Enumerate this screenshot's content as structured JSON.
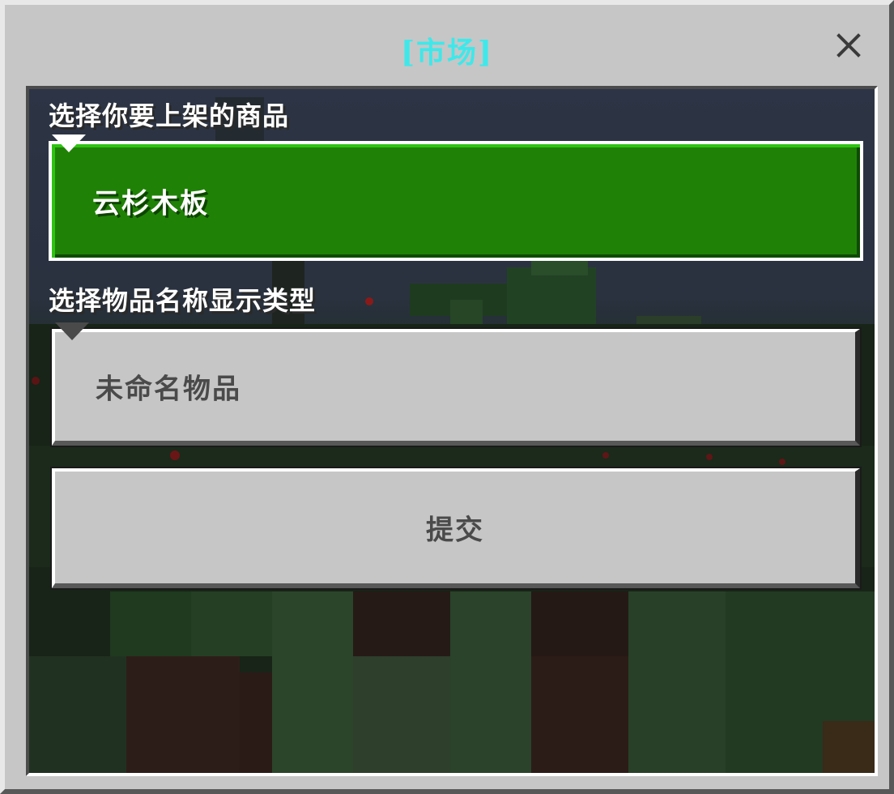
{
  "dialog": {
    "title": "[市场]",
    "title_color": "#3ee8ea",
    "close_icon": "close-icon"
  },
  "form": {
    "item_label": "选择你要上架的商品",
    "item_selected": "云杉木板",
    "name_type_label": "选择物品名称显示类型",
    "name_type_selected": "未命名物品",
    "submit_label": "提交",
    "dropdown_icon": "triangle-down-icon"
  },
  "colors": {
    "panel": "#c6c6c6",
    "selected_dropdown": "#1f8206"
  }
}
